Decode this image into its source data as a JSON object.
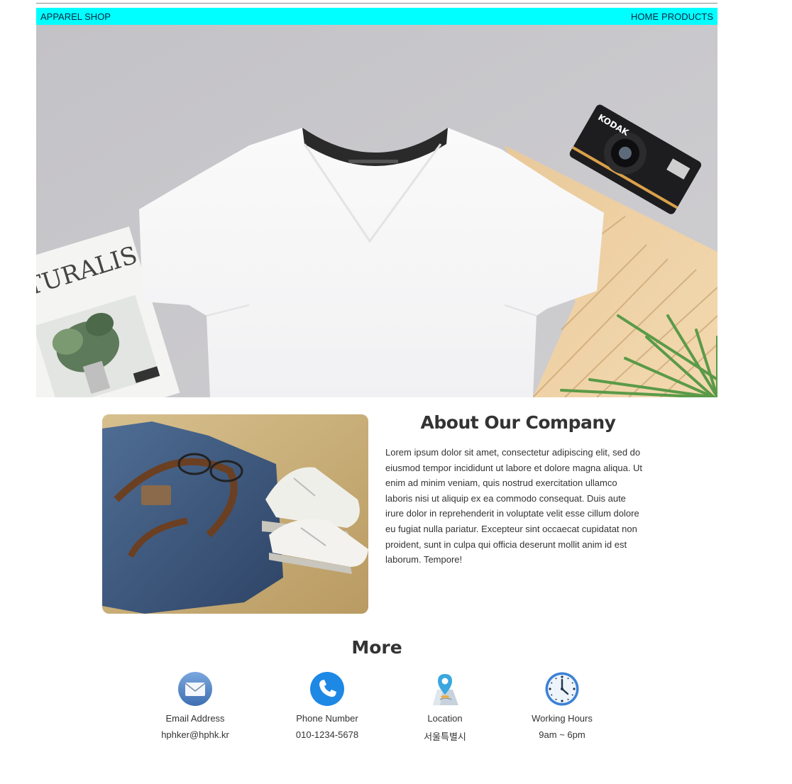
{
  "navbar": {
    "brand": "APPAREL SHOP",
    "links": [
      "HOME",
      "PRODUCTS"
    ],
    "bg_color": "#00ffff"
  },
  "hero": {
    "image": "white v-neck t-shirt flat lay with camera, magazine, wooden board and palm leaf",
    "magazine_text": "ATURALIS",
    "camera_brand": "KODAK"
  },
  "about": {
    "image": "denim bag with sunglasses and white sneakers on sand",
    "title": "About Our Company",
    "body": "Lorem ipsum dolor sit amet, consectetur adipiscing elit, sed do eiusmod tempor incididunt ut labore et dolore magna aliqua. Ut enim ad minim veniam, quis nostrud exercitation ullamco laboris nisi ut aliquip ex ea commodo consequat. Duis aute irure dolor in reprehenderit in voluptate velit esse cillum dolore eu fugiat nulla pariatur. Excepteur sint occaecat cupidatat non proident, sunt in culpa qui officia deserunt mollit anim id est laborum. Tempore!"
  },
  "more": {
    "title": "More",
    "items": [
      {
        "icon": "email-icon",
        "label": "Email Address",
        "value": "hphker@hphk.kr"
      },
      {
        "icon": "phone-icon",
        "label": "Phone Number",
        "value": "010-1234-5678"
      },
      {
        "icon": "location-icon",
        "label": "Location",
        "value": "서울특별시"
      },
      {
        "icon": "clock-icon",
        "label": "Working Hours",
        "value": "9am ~ 6pm"
      }
    ]
  }
}
